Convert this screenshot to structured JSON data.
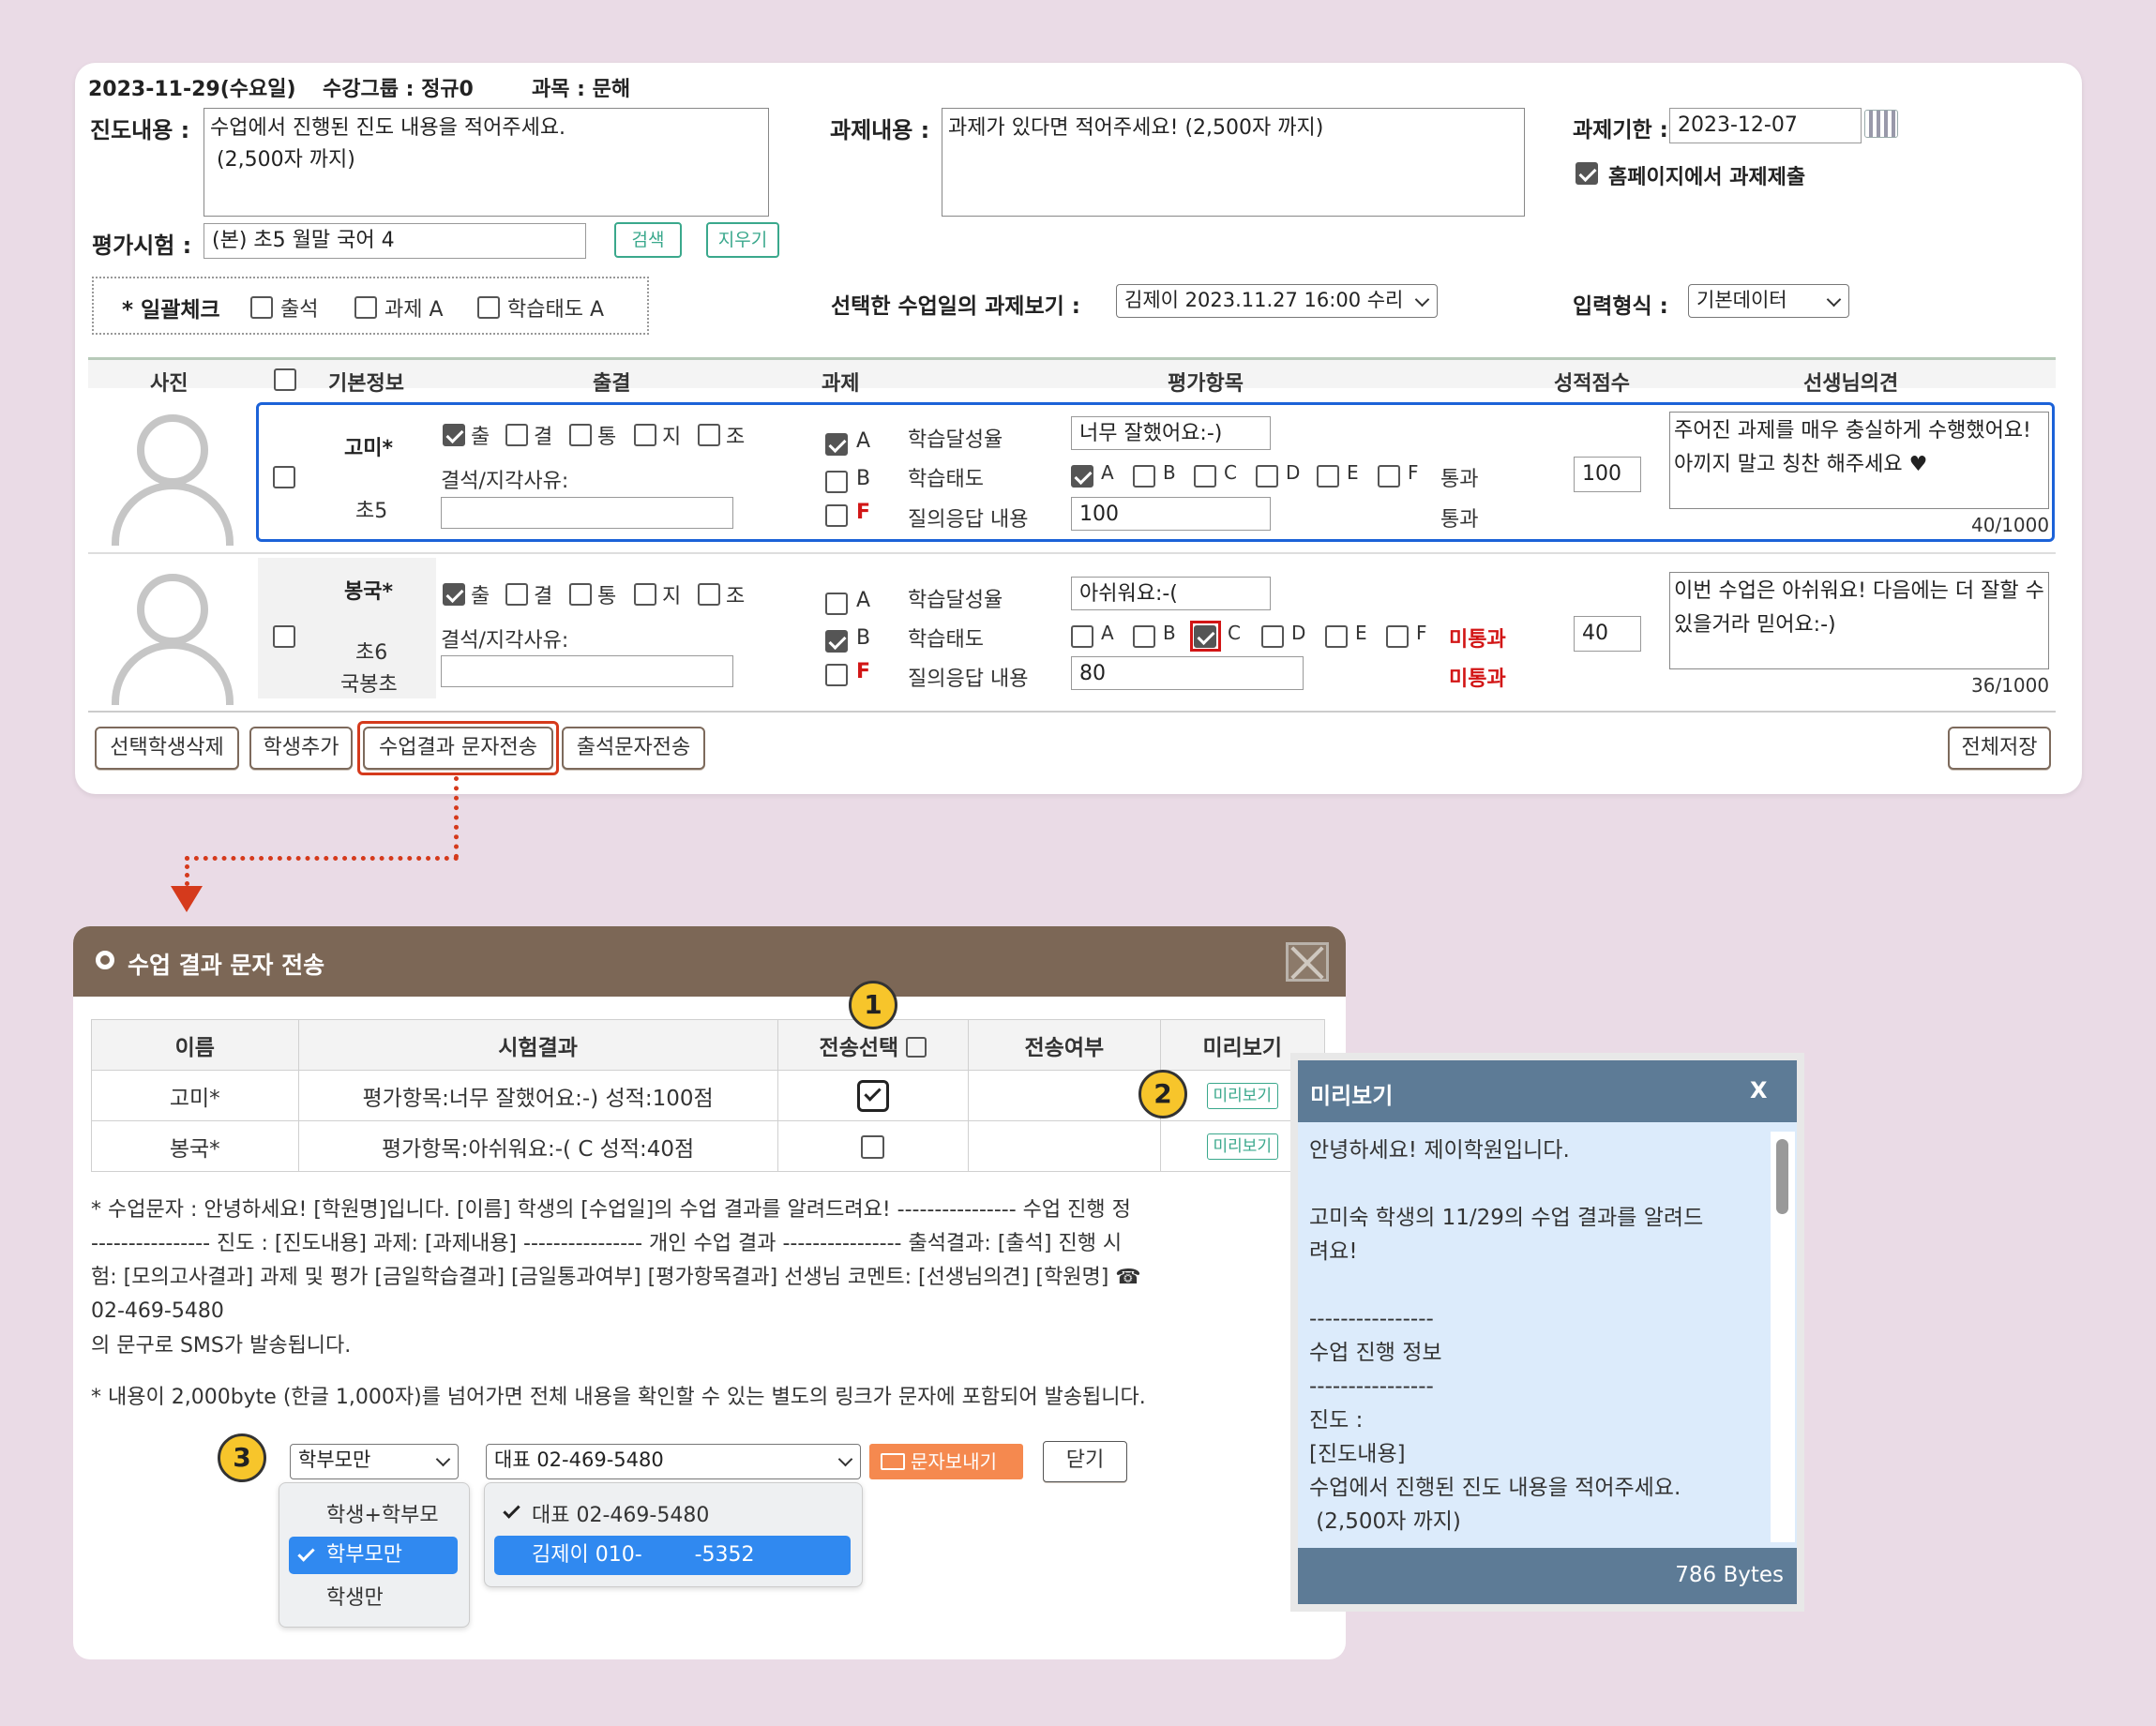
{
  "top": {
    "date": "2023-11-29(수요일)",
    "group": "수강그룹 : 정규0",
    "subject": "과목 : 문해",
    "progress_label": "진도내용 :",
    "progress_text": "수업에서 진행된 진도 내용을 적어주세요.\n (2,500자 까지)",
    "homework_label": "과제내용 :",
    "homework_text": "과제가 있다면 적어주세요! (2,500자 까지)",
    "deadline_label": "과제기한 :",
    "deadline_value": "2023-12-07",
    "homepage_submit_label": "홈페이지에서 과제제출",
    "exam_label": "평가시험 :",
    "exam_value": "(본) 초5 월말 국어 4",
    "search_btn": "검색",
    "clear_btn": "지우기",
    "bulk_label": "* 일괄체크",
    "bulk_items": [
      "출석",
      "과제 A",
      "학습태도 A"
    ],
    "view_hw_label": "선택한 수업일의 과제보기 :",
    "view_hw_value": "김제이 2023.11.27 16:00 수리",
    "input_format_label": "입력형식 :",
    "input_format_value": "기본데이터"
  },
  "table_headers": [
    "사진",
    "기본정보",
    "출결",
    "과제",
    "평가항목",
    "성적점수",
    "선생님의견"
  ],
  "attendance_options": [
    "출",
    "결",
    "통",
    "지",
    "조"
  ],
  "reason_label": "결석/지각사유:",
  "homework_options": [
    "A",
    "B",
    "F"
  ],
  "eval_labels": [
    "학습달성율",
    "학습태도",
    "질의응답 내용"
  ],
  "grade_options": [
    "A",
    "B",
    "C",
    "D",
    "E",
    "F"
  ],
  "students": [
    {
      "name": "고미*",
      "grade": "초5",
      "school": "",
      "achievement": "너무 잘했어요:-)",
      "qa": "100",
      "pass1": "통과",
      "pass2": "통과",
      "score": "100",
      "comment": "주어진 과제를 매우 충실하게 수행했어요! 아끼지 말고 칭찬 해주세요 ♥",
      "count": "40/1000"
    },
    {
      "name": "봉국*",
      "grade": "초6",
      "school": "국봉초",
      "achievement": "아쉬워요:-(",
      "qa": "80",
      "pass1": "미통과",
      "pass2": "미통과",
      "score": "40",
      "comment": "이번 수업은 아쉬워요! 다음에는 더 잘할 수 있을거라 믿어요:-)",
      "count": "36/1000"
    }
  ],
  "bottom_buttons": [
    "선택학생삭제",
    "학생추가",
    "수업결과 문자전송",
    "출석문자전송"
  ],
  "save_all": "전체저장",
  "modal": {
    "title": "수업 결과 문자 전송",
    "headers": [
      "이름",
      "시험결과",
      "전송선택",
      "전송여부",
      "미리보기"
    ],
    "rows": [
      {
        "name": "고미*",
        "result": "평가항목:너무 잘했어요:-) 성적:100점",
        "preview": "미리보기"
      },
      {
        "name": "봉국*",
        "result": "평가항목:아쉬워요:-( C 성적:40점",
        "preview": "미리보기"
      }
    ],
    "note1_l1": "* 수업문자 : 안녕하세요! [학원명]입니다. [이름] 학생의 [수업일]의 수업 결과를 알려드려요! ---------------- 수업 진행 정",
    "note1_l2": "---------------- 진도 : [진도내용] 과제: [과제내용] ---------------- 개인 수업 결과 ---------------- 출석결과: [출석] 진행 시",
    "note1_l3": "험: [모의고사결과] 과제 및 평가 [금일학습결과] [금일통과여부] [평가항목결과] 선생님 코멘트: [선생님의견] [학원명] ☎",
    "note1_l4": "02-469-5480",
    "note1_l5": "의 문구로 SMS가 발송됩니다.",
    "note2": "* 내용이 2,000byte (한글 1,000자)를 넘어가면 전체 내용을 확인할 수 있는 별도의 링크가 문자에 포함되어 발송됩니다.",
    "recipient_value": "학부모만",
    "sender_value": "대표 02-469-5480",
    "send_btn": "문자보내기",
    "close_btn": "닫기",
    "recipient_options": [
      "학생+학부모",
      "학부모만",
      "학생만"
    ],
    "sender_options": [
      "대표 02-469-5480",
      "김제이 010-        -5352"
    ]
  },
  "badges": [
    "1",
    "2",
    "3"
  ],
  "preview": {
    "title": "미리보기",
    "close": "X",
    "lines": [
      "안녕하세요! 제이학원입니다.",
      "",
      "고미숙 학생의 11/29의 수업 결과를 알려드",
      "려요!",
      "",
      "----------------",
      "수업 진행 정보",
      "----------------",
      "진도 :",
      "[진도내용]",
      "수업에서 진행된 진도 내용을 적어주세요.",
      " (2,500자 까지)"
    ],
    "bytes": "786 Bytes"
  }
}
